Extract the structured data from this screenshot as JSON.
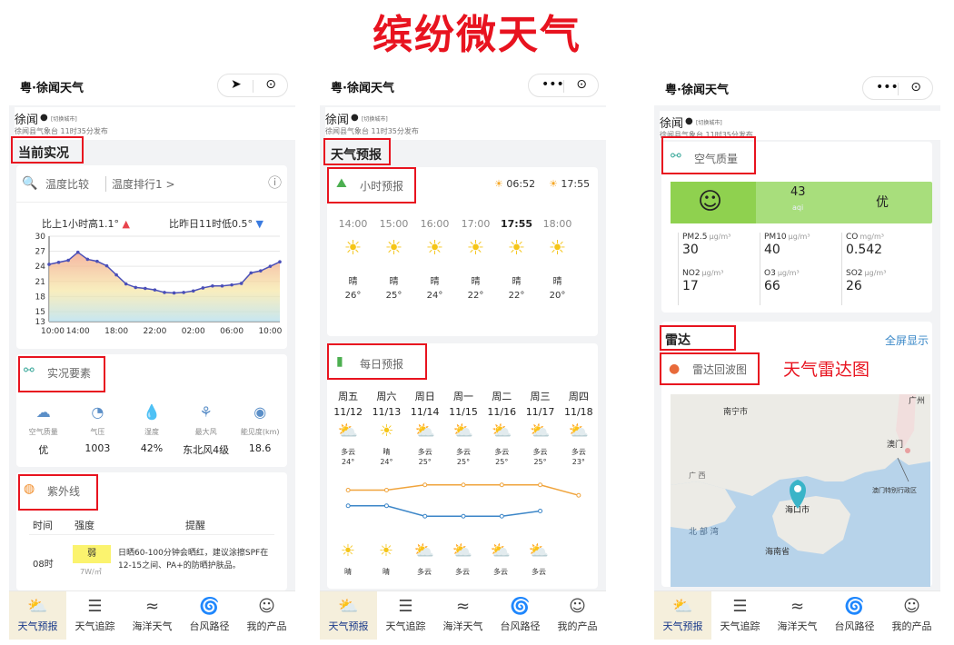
{
  "banner": "缤纷微天气",
  "app_name": "粤·徐闻天气",
  "city": "徐闻",
  "switch_city": "[切换城市]",
  "publish_info": "徐闻县气象台 11时35分发布",
  "capsule": {
    "more": "•••",
    "target": "⊙",
    "locate": "➤"
  },
  "tabs": [
    {
      "label": "天气预报",
      "icon": "weather-icon"
    },
    {
      "label": "天气追踪",
      "icon": "list-icon"
    },
    {
      "label": "海洋天气",
      "icon": "ocean-icon"
    },
    {
      "label": "台风路径",
      "icon": "typhoon-icon"
    },
    {
      "label": "我的产品",
      "icon": "user-icon"
    }
  ],
  "screen1": {
    "section_now": "当前实况",
    "temp_compare": "温度比较",
    "temp_rank": "温度排行1 >",
    "vs_hour": "比上1小时高1.1°",
    "vs_yesterday": "比昨日11时低0.5°",
    "chart_data": {
      "type": "line",
      "x": [
        "11:00",
        "12:00",
        "13:00",
        "14:00",
        "15:00",
        "16:00",
        "17:00",
        "18:00",
        "19:00",
        "20:00",
        "21:00",
        "22:00",
        "23:00",
        "00:00",
        "01:00",
        "02:00",
        "03:00",
        "04:00",
        "05:00",
        "06:00",
        "07:00",
        "08:00",
        "09:00",
        "10:00",
        "11:00"
      ],
      "values": [
        24.4,
        24.8,
        25.2,
        26.8,
        25.4,
        25.0,
        24.1,
        22.3,
        20.5,
        19.8,
        19.6,
        19.3,
        18.8,
        18.7,
        18.8,
        19.1,
        19.7,
        20.1,
        20.1,
        20.3,
        20.6,
        22.7,
        23.1,
        24.0,
        24.9
      ],
      "xticks": [
        "10:00",
        "14:00",
        "18:00",
        "22:00",
        "02:00",
        "06:00",
        "10:00"
      ],
      "yticks": [
        13,
        15,
        18,
        21,
        24,
        27,
        30
      ],
      "ylim": [
        13,
        30
      ]
    },
    "section_elements": "实况要素",
    "elements": [
      {
        "label": "空气质量",
        "value": "优",
        "icon": "aqi-icon"
      },
      {
        "label": "气压",
        "value": "1003",
        "icon": "pressure-icon"
      },
      {
        "label": "湿度",
        "value": "42%",
        "icon": "humidity-icon"
      },
      {
        "label": "最大风",
        "value": "东北风4级",
        "icon": "wind-icon"
      },
      {
        "label": "能见度(km)",
        "value": "18.6",
        "icon": "visibility-icon"
      }
    ],
    "section_uv": "紫外线",
    "uv_headers": [
      "时间",
      "强度",
      "提醒"
    ],
    "uv_row": {
      "time": "08时",
      "level": "弱",
      "unit": "7W/㎡",
      "tip": "日晒60-100分钟会晒红，建议涂擦SPF在12-15之间、PA+的防晒护肤品。"
    }
  },
  "screen2": {
    "section": "天气预报",
    "hourly_title": "小时预报",
    "sunrise": "06:52",
    "sunset": "17:55",
    "hours": [
      {
        "time": "14:00",
        "cond": "晴",
        "temp": "26°"
      },
      {
        "time": "15:00",
        "cond": "晴",
        "temp": "25°"
      },
      {
        "time": "16:00",
        "cond": "晴",
        "temp": "24°"
      },
      {
        "time": "17:00",
        "cond": "晴",
        "temp": "22°"
      },
      {
        "time": "17:55",
        "cond": "晴",
        "temp": "22°"
      },
      {
        "time": "18:00",
        "cond": "晴",
        "temp": "20°"
      }
    ],
    "daily_title": "每日预报",
    "days": [
      {
        "week": "周五",
        "date": "11/12",
        "cond": "多云",
        "hi": "24°",
        "lo": "21°"
      },
      {
        "week": "周六",
        "date": "11/13",
        "cond": "晴",
        "hi": "24°",
        "lo": "21°"
      },
      {
        "week": "周日",
        "date": "11/14",
        "cond": "多云",
        "hi": "25°",
        "lo": "19°"
      },
      {
        "week": "周一",
        "date": "11/15",
        "cond": "多云",
        "hi": "25°",
        "lo": "19°"
      },
      {
        "week": "周二",
        "date": "11/16",
        "cond": "多云",
        "hi": "25°",
        "lo": "19°"
      },
      {
        "week": "周三",
        "date": "11/17",
        "cond": "多云",
        "hi": "25°",
        "lo": "20°"
      },
      {
        "week": "周四",
        "date": "11/18",
        "cond": "多云",
        "hi": "23°",
        "lo": "20°"
      }
    ],
    "nights": [
      "晴",
      "晴",
      "多云",
      "多云",
      "多云",
      "多云"
    ]
  },
  "screen3": {
    "aqi_title": "空气质量",
    "aqi_value": "43",
    "aqi_unit": "aqi",
    "aqi_level": "优",
    "pollutants": [
      {
        "name": "PM2.5",
        "unit": "μg/m³",
        "value": "30"
      },
      {
        "name": "PM10",
        "unit": "μg/m³",
        "value": "40"
      },
      {
        "name": "CO",
        "unit": "mg/m³",
        "value": "0.542"
      },
      {
        "name": "NO2",
        "unit": "μg/m³",
        "value": "17"
      },
      {
        "name": "O3",
        "unit": "μg/m³",
        "value": "66"
      },
      {
        "name": "SO2",
        "unit": "μg/m³",
        "value": "26"
      }
    ],
    "radar_section": "雷达",
    "fullscreen": "全屏显示",
    "radar_title": "雷达回波图",
    "radar_caption": "天气雷达图",
    "map_labels": {
      "nanning": "南宁市",
      "guangzhou": "广州",
      "macau": "澳门",
      "macau_region": "澳门特别行政区",
      "haikou": "海口市",
      "hainan": "海南省",
      "gulf": "北 部 湾",
      "guangxi": "广 西"
    }
  },
  "colors": {
    "accent_red": "#e8131f",
    "aqi_green": "#8fd14f",
    "sun": "#f5c518",
    "line_orange": "#f0a43c",
    "line_blue": "#3c86c8"
  }
}
